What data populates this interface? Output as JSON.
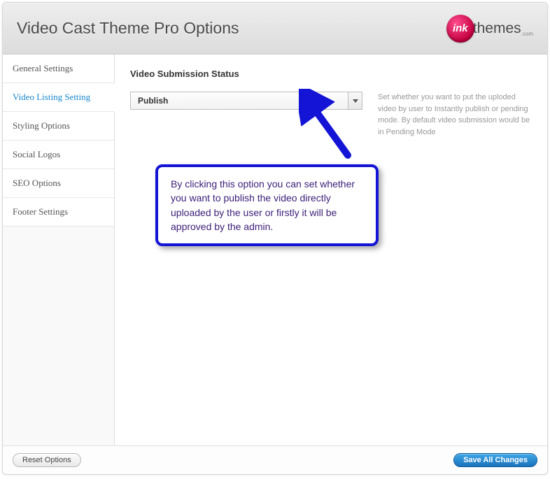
{
  "header": {
    "title": "Video Cast Theme Pro Options",
    "logo": {
      "circle_text": "ink",
      "text": "themes",
      "sub": ".com"
    }
  },
  "sidebar": {
    "items": [
      {
        "label": "General Settings",
        "active": false
      },
      {
        "label": "Video Listing Setting",
        "active": true
      },
      {
        "label": "Styling Options",
        "active": false
      },
      {
        "label": "Social Logos",
        "active": false
      },
      {
        "label": "SEO Options",
        "active": false
      },
      {
        "label": "Footer Settings",
        "active": false
      }
    ]
  },
  "main": {
    "section_title": "Video Submission Status",
    "select_value": "Publish",
    "help_text": "Set whether you want to put the uploded video by user to Instantly publish or pending mode. By default video submission would be in Pending Mode"
  },
  "callout": {
    "text": "By clicking this option you can set whether you want to publish the video directly uploaded by the user or firstly it will be approved by the admin."
  },
  "footer": {
    "reset_label": "Reset Options",
    "save_label": "Save All Changes"
  }
}
